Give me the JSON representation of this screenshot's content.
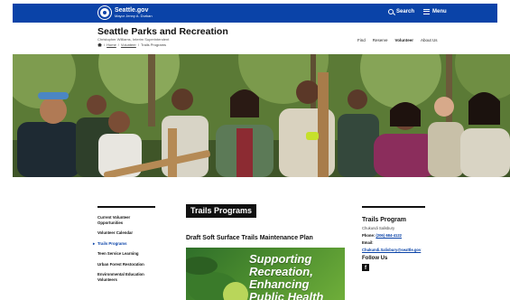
{
  "topbar": {
    "logo_title": "Seattle.gov",
    "logo_sub": "Mayor Jenny A. Durkan",
    "search_label": "Search",
    "menu_label": "Menu",
    "brand_color": "#0a43a8"
  },
  "header": {
    "title": "Seattle Parks and Recreation",
    "subtitle": "Christopher Williams, Interim Superintendent",
    "breadcrumb": {
      "home": "Home",
      "volunteer": "Volunteer",
      "current": "Trails Programs"
    },
    "nav": [
      "Find",
      "Reserve",
      "Volunteer",
      "About Us"
    ]
  },
  "sidebar": {
    "items": [
      {
        "label": "Current Volunteer Opportunities"
      },
      {
        "label": "Volunteer Calendar"
      },
      {
        "label": "Trails Programs"
      },
      {
        "label": "Teen Service Learning"
      },
      {
        "label": "Urban Forest Restoration"
      },
      {
        "label": "Environmental Education Volunteers"
      }
    ]
  },
  "main": {
    "heading": "Trails Programs",
    "subheading": "Draft Soft Surface Trails Maintenance Plan",
    "promo_lines": [
      "Supporting",
      "Recreation,",
      "Enhancing",
      "Public Health"
    ]
  },
  "contact": {
    "title": "Trails Program",
    "name": "Chukundi Salisbury",
    "phone_label": "Phone:",
    "phone": "(206) 684-4122",
    "email_label": "Email:",
    "email": "Chukundi.Salisbury@seattle.gov",
    "follow_label": "Follow Us",
    "facebook_glyph": "f"
  }
}
